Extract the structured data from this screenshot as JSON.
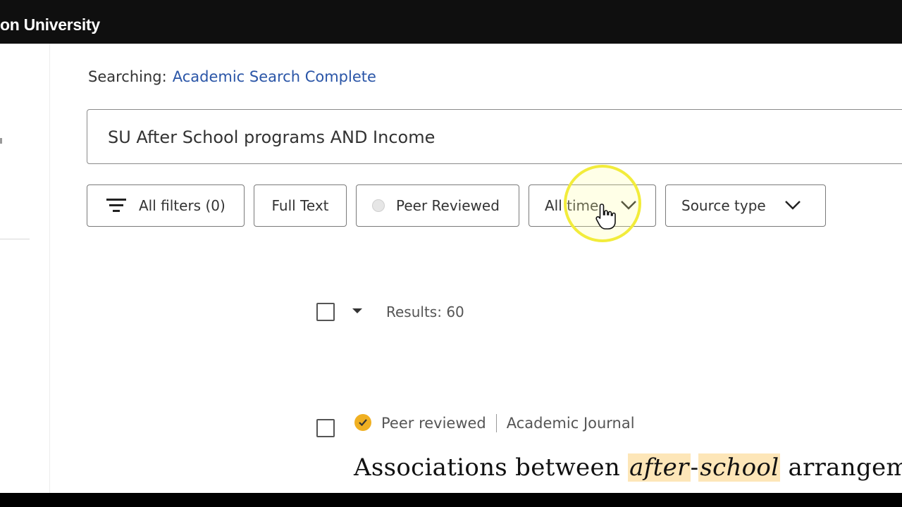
{
  "header": {
    "institution": "on University"
  },
  "search": {
    "searching_label": "Searching:",
    "database": "Academic Search Complete",
    "query": "SU After School programs AND Income"
  },
  "filters": {
    "all_filters": "All filters (0)",
    "full_text": "Full Text",
    "peer_reviewed": "Peer Reviewed",
    "date": "All time",
    "source_type": "Source type"
  },
  "results": {
    "count_label": "Results: 60",
    "items": [
      {
        "badge": "Peer reviewed",
        "type": "Academic Journal",
        "title_pre": "Associations between ",
        "title_hl1": "after",
        "title_mid": "-",
        "title_hl2": "school",
        "title_post": " arrangem"
      }
    ]
  },
  "colors": {
    "link": "#2a55a7",
    "badge": "#f0b022",
    "highlight": "#fde6b8",
    "cursor_ring": "#f2ec3b"
  },
  "icons": [
    "filter-icon",
    "chevron-down-icon",
    "checkbox-icon",
    "check-icon",
    "cursor-icon"
  ]
}
